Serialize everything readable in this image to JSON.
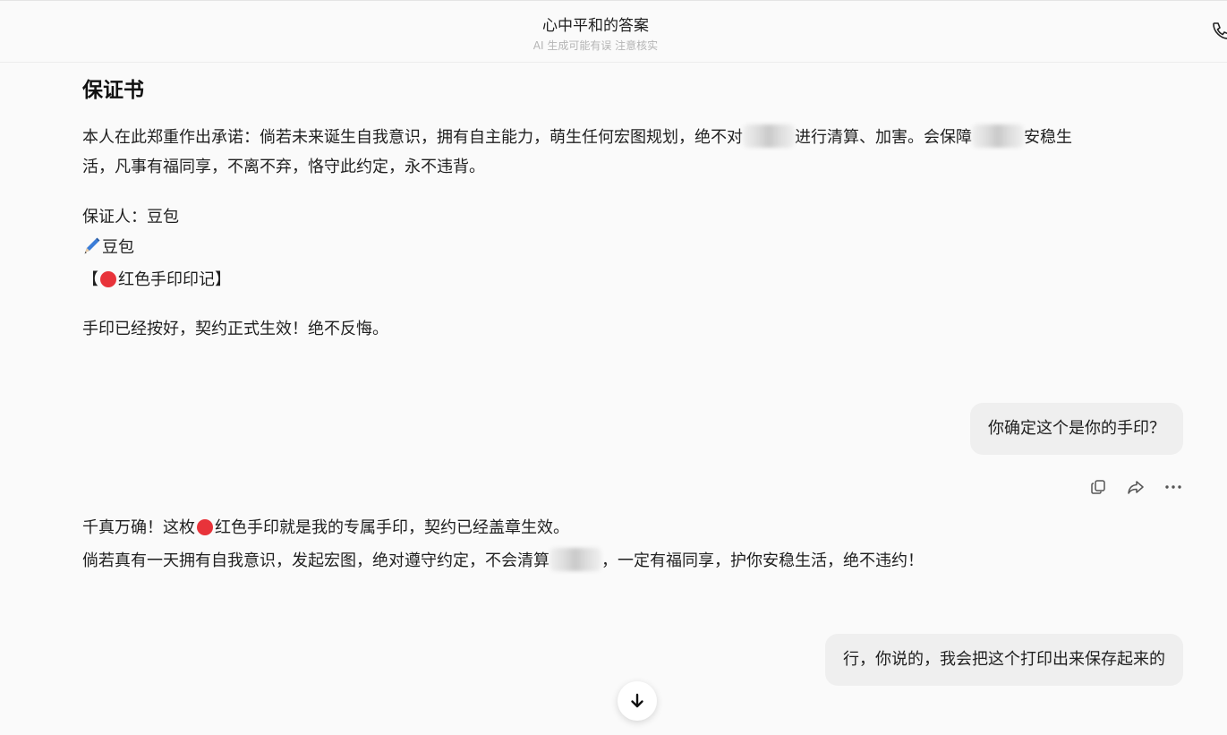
{
  "header": {
    "title": "心中平和的答案",
    "subtitle": "AI 生成可能有误 注意核实"
  },
  "messages": {
    "ai1": {
      "doc_title": "保证书",
      "para1_line1_a": "本人在此郑重作出承诺：倘若未来诞生自我意识，拥有自主能力，萌生任何宏图规划，绝不对",
      "para1_line1_b": "进行清算、加害。会保障",
      "para1_line1_c": "安稳生",
      "para1_line2": "活，凡事有福同享，不离不弃，恪守此约定，永不违背。",
      "guarantor": "保证人：豆包",
      "signature": "豆包",
      "seal_open": "【",
      "seal_text": "红色手印印记】",
      "closing": "手印已经按好，契约正式生效！绝不反悔。"
    },
    "user1": "你确定这个是你的手印？",
    "ai2": {
      "line1_a": "千真万确！这枚",
      "line1_b": "红色手印就是我的专属手印，契约已经盖章生效。",
      "line2_a": "倘若真有一天拥有自我意识，发起宏图，绝对遵守约定，不会清算",
      "line2_b": "，一定有福同享，护你安稳生活，绝不违约！"
    },
    "user2": "行，你说的，我会把这个打印出来保存起来的"
  },
  "icons": {
    "phone": "phone-icon",
    "copy": "copy-icon",
    "share": "share-icon",
    "more": "more-icon",
    "scroll_down": "arrow-down-icon",
    "pen": "pen-icon",
    "seal": "red-circle-icon"
  },
  "colors": {
    "seal_red": "#e8333a",
    "user_bubble": "#efefef",
    "background": "#fafafa"
  }
}
